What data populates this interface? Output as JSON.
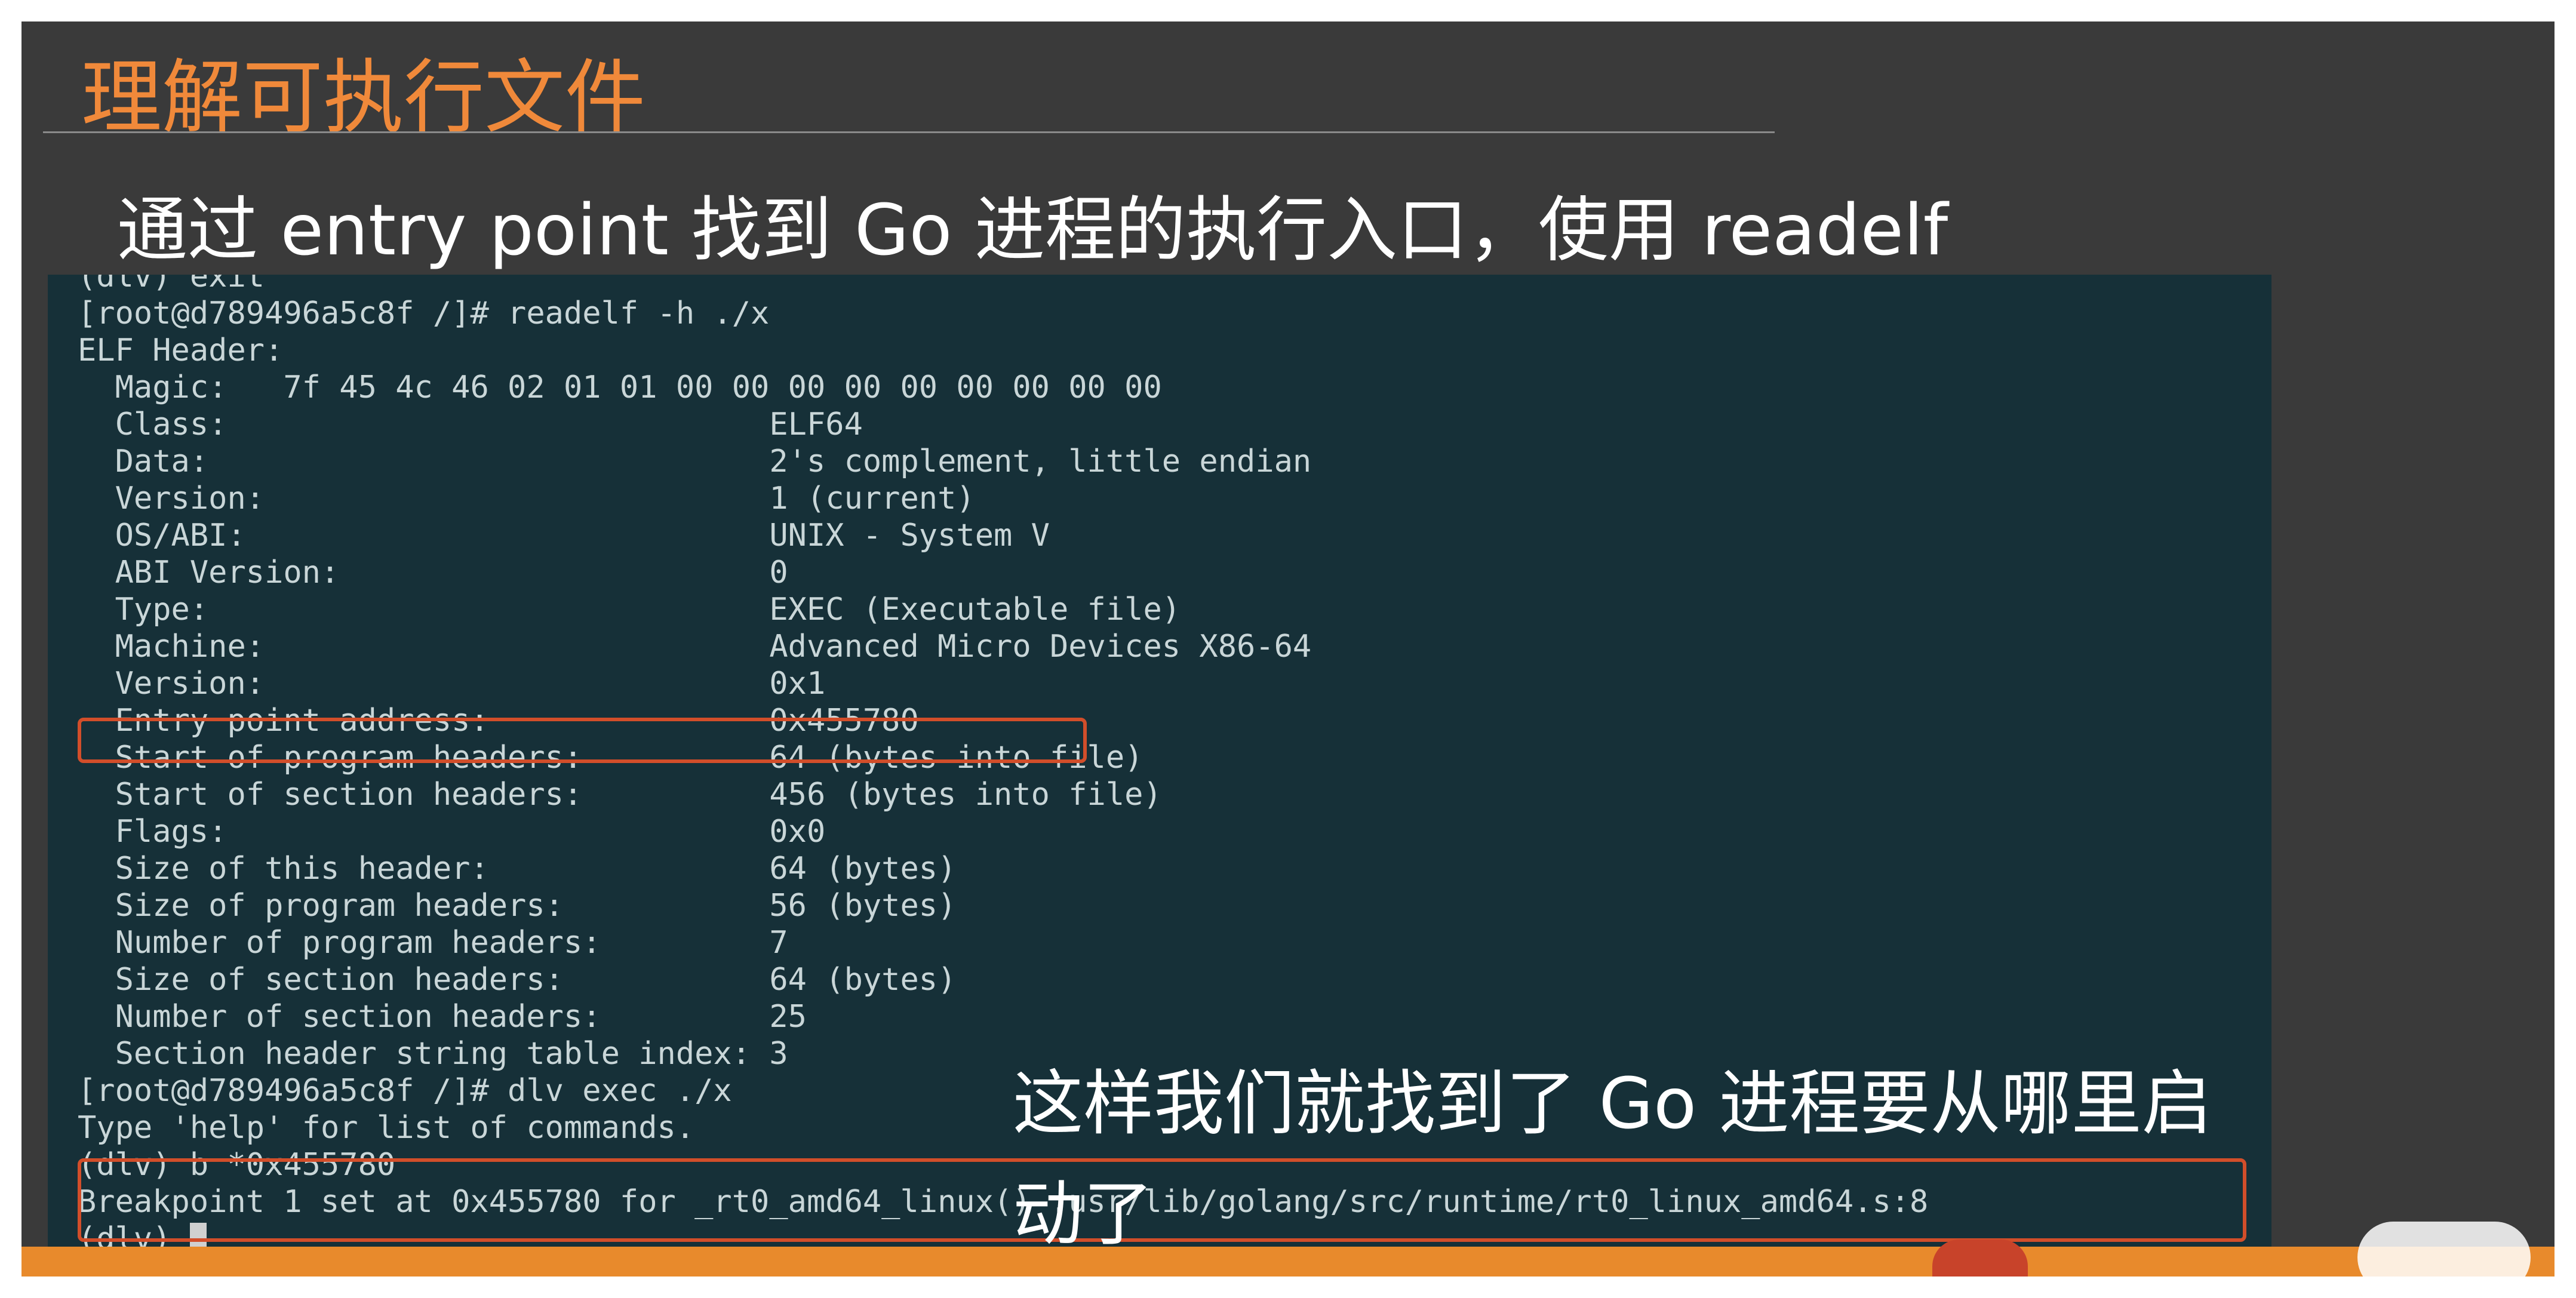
{
  "slide": {
    "title": "理解可执行文件",
    "subtitle": "通过 entry point 找到 Go 进程的执行入口，使用 readelf",
    "caption_line1": "这样我们就找到了 Go 进程要从哪里启",
    "caption_line2": "动了"
  },
  "terminal": {
    "lines": [
      "(dlv) exit",
      "[root@d789496a5c8f /]# readelf -h ./x",
      "ELF Header:",
      "  Magic:   7f 45 4c 46 02 01 01 00 00 00 00 00 00 00 00 00",
      "  Class:                             ELF64",
      "  Data:                              2's complement, little endian",
      "  Version:                           1 (current)",
      "  OS/ABI:                            UNIX - System V",
      "  ABI Version:                       0",
      "  Type:                              EXEC (Executable file)",
      "  Machine:                           Advanced Micro Devices X86-64",
      "  Version:                           0x1",
      "  Entry point address:               0x455780",
      "  Start of program headers:          64 (bytes into file)",
      "  Start of section headers:          456 (bytes into file)",
      "  Flags:                             0x0",
      "  Size of this header:               64 (bytes)",
      "  Size of program headers:           56 (bytes)",
      "  Number of program headers:         7",
      "  Size of section headers:           64 (bytes)",
      "  Number of section headers:         25",
      "  Section header string table index: 3",
      "[root@d789496a5c8f /]# dlv exec ./x",
      "Type 'help' for list of commands.",
      "(dlv) b *0x455780",
      "Breakpoint 1 set at 0x455780 for _rt0_amd64_linux() .usr/lib/golang/src/runtime/rt0_linux_amd64.s:8",
      "(dlv) "
    ]
  },
  "colors": {
    "title": "#f0893a",
    "slide_bg": "#3a3a3a",
    "terminal_bg": "#163038",
    "terminal_text": "#c9d6d8",
    "highlight_box": "#d24e2a"
  }
}
